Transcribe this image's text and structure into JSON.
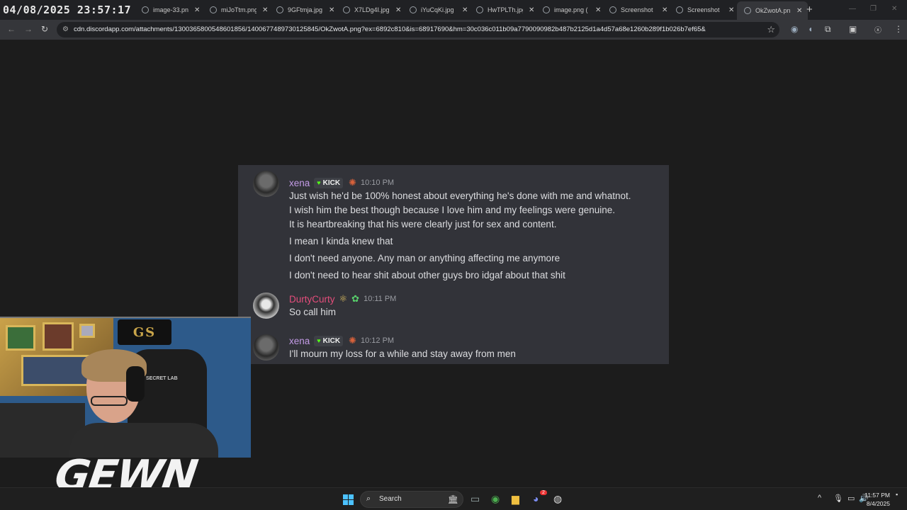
{
  "overlay": {
    "datetime": "04/08/2025 23:57:17",
    "brand": "GEWN"
  },
  "browser": {
    "tabs": [
      {
        "title": "image-33.pn"
      },
      {
        "title": "miJoTtm.png"
      },
      {
        "title": "9GFtmja.jpg"
      },
      {
        "title": "X7LDg4I.jpg"
      },
      {
        "title": "iYuCqKi.jpg"
      },
      {
        "title": "HwTPLTh.jpg"
      },
      {
        "title": "image.png ("
      },
      {
        "title": "Screenshot"
      },
      {
        "title": "Screenshot"
      },
      {
        "title": "OkZwotA.pn"
      }
    ],
    "active_tab_index": 9,
    "url": "cdn.discordapp.com/attachments/1300365800548601856/1400677489730125845/OkZwotA.png?ex=6892c810&is=68917690&hm=30c036c011b09a7790090982b487b2125d1a4d57a68e1260b289f1b026b7ef65&"
  },
  "discord": {
    "messages": [
      {
        "author": "xena",
        "author_color": "#c39be6",
        "kick_badge": "KICK",
        "time": "10:10 PM",
        "lines": [
          "Just wish he'd be 100% honest about everything he's done with me and whatnot.",
          "I wish him the best though because I love him and my feelings were genuine.",
          "It is heartbreaking that his were clearly just for sex and content.",
          "I mean I kinda knew that",
          "I don't need anyone. Any man or anything affecting me anymore",
          "I don't need to hear shit about other guys bro idgaf about that shit"
        ]
      },
      {
        "author": "DurtyCurty",
        "author_color": "#e44d7b",
        "time": "10:11 PM",
        "lines": [
          "So call him"
        ]
      },
      {
        "author": "xena",
        "author_color": "#c39be6",
        "kick_badge": "KICK",
        "time": "10:12 PM",
        "lines": [
          "I'll mourn my loss for a while and stay away from men"
        ]
      }
    ]
  },
  "webcam": {
    "logo_text": "GS",
    "chair_text": "SECRET LAB"
  },
  "taskbar": {
    "search_label": "Search",
    "discord_badge": "2",
    "time": "11:57 PM",
    "date": "8/4/2025"
  }
}
